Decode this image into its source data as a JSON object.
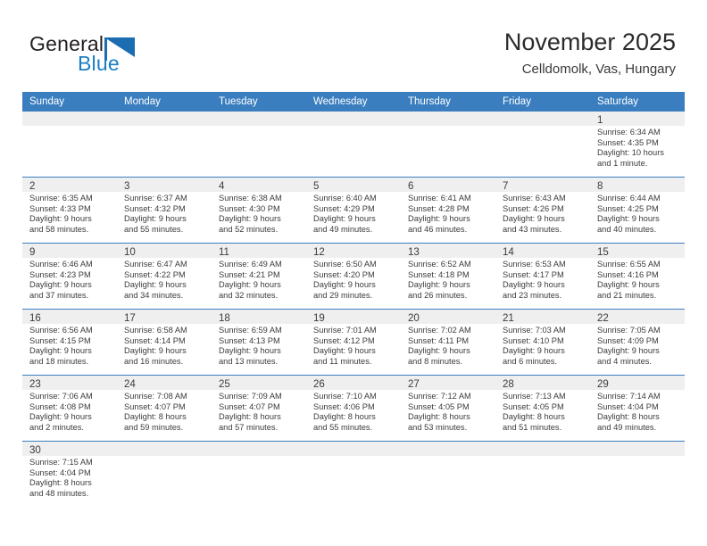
{
  "branding": {
    "logo_text_primary": "General",
    "logo_text_secondary": "Blue",
    "logo_icon": "blue-flag-triangle-icon",
    "accent_color": "#3a7ebf",
    "logo_blue": "#1b7ec2"
  },
  "header": {
    "title": "November 2025",
    "subtitle": "Celldomolk, Vas, Hungary"
  },
  "weekday_headers": [
    "Sunday",
    "Monday",
    "Tuesday",
    "Wednesday",
    "Thursday",
    "Friday",
    "Saturday"
  ],
  "labels": {
    "sunrise_prefix": "Sunrise:",
    "sunset_prefix": "Sunset:",
    "daylight_prefix": "Daylight:"
  },
  "weeks": [
    [
      {
        "empty": true
      },
      {
        "empty": true
      },
      {
        "empty": true
      },
      {
        "empty": true
      },
      {
        "empty": true
      },
      {
        "empty": true
      },
      {
        "day": "1",
        "sunrise": "Sunrise: 6:34 AM",
        "sunset": "Sunset: 4:35 PM",
        "daylight_line1": "Daylight: 10 hours",
        "daylight_line2": "and 1 minute."
      }
    ],
    [
      {
        "day": "2",
        "sunrise": "Sunrise: 6:35 AM",
        "sunset": "Sunset: 4:33 PM",
        "daylight_line1": "Daylight: 9 hours",
        "daylight_line2": "and 58 minutes."
      },
      {
        "day": "3",
        "sunrise": "Sunrise: 6:37 AM",
        "sunset": "Sunset: 4:32 PM",
        "daylight_line1": "Daylight: 9 hours",
        "daylight_line2": "and 55 minutes."
      },
      {
        "day": "4",
        "sunrise": "Sunrise: 6:38 AM",
        "sunset": "Sunset: 4:30 PM",
        "daylight_line1": "Daylight: 9 hours",
        "daylight_line2": "and 52 minutes."
      },
      {
        "day": "5",
        "sunrise": "Sunrise: 6:40 AM",
        "sunset": "Sunset: 4:29 PM",
        "daylight_line1": "Daylight: 9 hours",
        "daylight_line2": "and 49 minutes."
      },
      {
        "day": "6",
        "sunrise": "Sunrise: 6:41 AM",
        "sunset": "Sunset: 4:28 PM",
        "daylight_line1": "Daylight: 9 hours",
        "daylight_line2": "and 46 minutes."
      },
      {
        "day": "7",
        "sunrise": "Sunrise: 6:43 AM",
        "sunset": "Sunset: 4:26 PM",
        "daylight_line1": "Daylight: 9 hours",
        "daylight_line2": "and 43 minutes."
      },
      {
        "day": "8",
        "sunrise": "Sunrise: 6:44 AM",
        "sunset": "Sunset: 4:25 PM",
        "daylight_line1": "Daylight: 9 hours",
        "daylight_line2": "and 40 minutes."
      }
    ],
    [
      {
        "day": "9",
        "sunrise": "Sunrise: 6:46 AM",
        "sunset": "Sunset: 4:23 PM",
        "daylight_line1": "Daylight: 9 hours",
        "daylight_line2": "and 37 minutes."
      },
      {
        "day": "10",
        "sunrise": "Sunrise: 6:47 AM",
        "sunset": "Sunset: 4:22 PM",
        "daylight_line1": "Daylight: 9 hours",
        "daylight_line2": "and 34 minutes."
      },
      {
        "day": "11",
        "sunrise": "Sunrise: 6:49 AM",
        "sunset": "Sunset: 4:21 PM",
        "daylight_line1": "Daylight: 9 hours",
        "daylight_line2": "and 32 minutes."
      },
      {
        "day": "12",
        "sunrise": "Sunrise: 6:50 AM",
        "sunset": "Sunset: 4:20 PM",
        "daylight_line1": "Daylight: 9 hours",
        "daylight_line2": "and 29 minutes."
      },
      {
        "day": "13",
        "sunrise": "Sunrise: 6:52 AM",
        "sunset": "Sunset: 4:18 PM",
        "daylight_line1": "Daylight: 9 hours",
        "daylight_line2": "and 26 minutes."
      },
      {
        "day": "14",
        "sunrise": "Sunrise: 6:53 AM",
        "sunset": "Sunset: 4:17 PM",
        "daylight_line1": "Daylight: 9 hours",
        "daylight_line2": "and 23 minutes."
      },
      {
        "day": "15",
        "sunrise": "Sunrise: 6:55 AM",
        "sunset": "Sunset: 4:16 PM",
        "daylight_line1": "Daylight: 9 hours",
        "daylight_line2": "and 21 minutes."
      }
    ],
    [
      {
        "day": "16",
        "sunrise": "Sunrise: 6:56 AM",
        "sunset": "Sunset: 4:15 PM",
        "daylight_line1": "Daylight: 9 hours",
        "daylight_line2": "and 18 minutes."
      },
      {
        "day": "17",
        "sunrise": "Sunrise: 6:58 AM",
        "sunset": "Sunset: 4:14 PM",
        "daylight_line1": "Daylight: 9 hours",
        "daylight_line2": "and 16 minutes."
      },
      {
        "day": "18",
        "sunrise": "Sunrise: 6:59 AM",
        "sunset": "Sunset: 4:13 PM",
        "daylight_line1": "Daylight: 9 hours",
        "daylight_line2": "and 13 minutes."
      },
      {
        "day": "19",
        "sunrise": "Sunrise: 7:01 AM",
        "sunset": "Sunset: 4:12 PM",
        "daylight_line1": "Daylight: 9 hours",
        "daylight_line2": "and 11 minutes."
      },
      {
        "day": "20",
        "sunrise": "Sunrise: 7:02 AM",
        "sunset": "Sunset: 4:11 PM",
        "daylight_line1": "Daylight: 9 hours",
        "daylight_line2": "and 8 minutes."
      },
      {
        "day": "21",
        "sunrise": "Sunrise: 7:03 AM",
        "sunset": "Sunset: 4:10 PM",
        "daylight_line1": "Daylight: 9 hours",
        "daylight_line2": "and 6 minutes."
      },
      {
        "day": "22",
        "sunrise": "Sunrise: 7:05 AM",
        "sunset": "Sunset: 4:09 PM",
        "daylight_line1": "Daylight: 9 hours",
        "daylight_line2": "and 4 minutes."
      }
    ],
    [
      {
        "day": "23",
        "sunrise": "Sunrise: 7:06 AM",
        "sunset": "Sunset: 4:08 PM",
        "daylight_line1": "Daylight: 9 hours",
        "daylight_line2": "and 2 minutes."
      },
      {
        "day": "24",
        "sunrise": "Sunrise: 7:08 AM",
        "sunset": "Sunset: 4:07 PM",
        "daylight_line1": "Daylight: 8 hours",
        "daylight_line2": "and 59 minutes."
      },
      {
        "day": "25",
        "sunrise": "Sunrise: 7:09 AM",
        "sunset": "Sunset: 4:07 PM",
        "daylight_line1": "Daylight: 8 hours",
        "daylight_line2": "and 57 minutes."
      },
      {
        "day": "26",
        "sunrise": "Sunrise: 7:10 AM",
        "sunset": "Sunset: 4:06 PM",
        "daylight_line1": "Daylight: 8 hours",
        "daylight_line2": "and 55 minutes."
      },
      {
        "day": "27",
        "sunrise": "Sunrise: 7:12 AM",
        "sunset": "Sunset: 4:05 PM",
        "daylight_line1": "Daylight: 8 hours",
        "daylight_line2": "and 53 minutes."
      },
      {
        "day": "28",
        "sunrise": "Sunrise: 7:13 AM",
        "sunset": "Sunset: 4:05 PM",
        "daylight_line1": "Daylight: 8 hours",
        "daylight_line2": "and 51 minutes."
      },
      {
        "day": "29",
        "sunrise": "Sunrise: 7:14 AM",
        "sunset": "Sunset: 4:04 PM",
        "daylight_line1": "Daylight: 8 hours",
        "daylight_line2": "and 49 minutes."
      }
    ],
    [
      {
        "day": "30",
        "sunrise": "Sunrise: 7:15 AM",
        "sunset": "Sunset: 4:04 PM",
        "daylight_line1": "Daylight: 8 hours",
        "daylight_line2": "and 48 minutes."
      },
      {
        "empty": true
      },
      {
        "empty": true
      },
      {
        "empty": true
      },
      {
        "empty": true
      },
      {
        "empty": true
      },
      {
        "empty": true
      }
    ]
  ]
}
